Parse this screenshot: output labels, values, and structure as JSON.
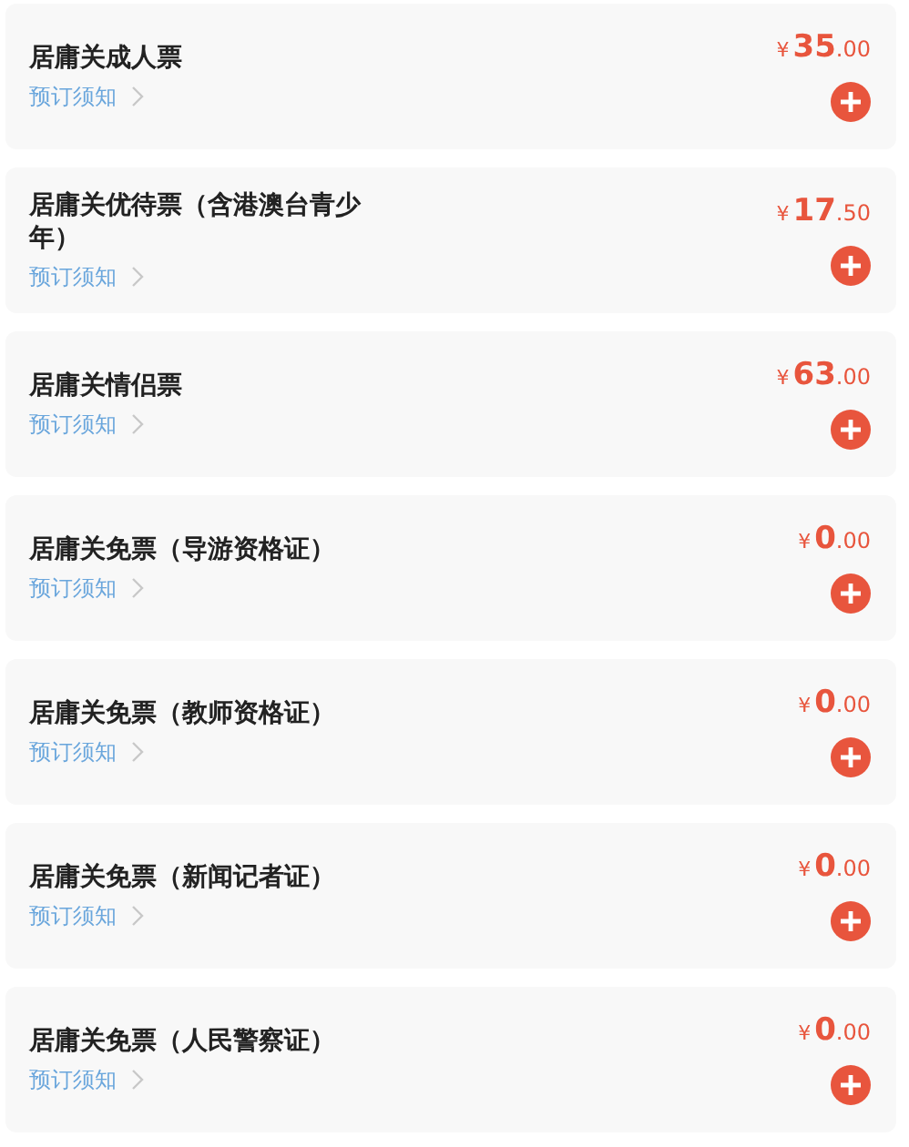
{
  "tickets": [
    {
      "title": "居庸关成人票",
      "notice": "预订须知",
      "currency": "¥",
      "amount": "35",
      "decimal": ".00"
    },
    {
      "title": "居庸关优待票（含港澳台青少年）",
      "notice": "预订须知",
      "currency": "¥",
      "amount": "17",
      "decimal": ".50"
    },
    {
      "title": "居庸关情侣票",
      "notice": "预订须知",
      "currency": "¥",
      "amount": "63",
      "decimal": ".00"
    },
    {
      "title": "居庸关免票（导游资格证）",
      "notice": "预订须知",
      "currency": "¥",
      "amount": "0",
      "decimal": ".00"
    },
    {
      "title": "居庸关免票（教师资格证）",
      "notice": "预订须知",
      "currency": "¥",
      "amount": "0",
      "decimal": ".00"
    },
    {
      "title": "居庸关免票（新闻记者证）",
      "notice": "预订须知",
      "currency": "¥",
      "amount": "0",
      "decimal": ".00"
    },
    {
      "title": "居庸关免票（人民警察证）",
      "notice": "预订须知",
      "currency": "¥",
      "amount": "0",
      "decimal": ".00"
    }
  ]
}
